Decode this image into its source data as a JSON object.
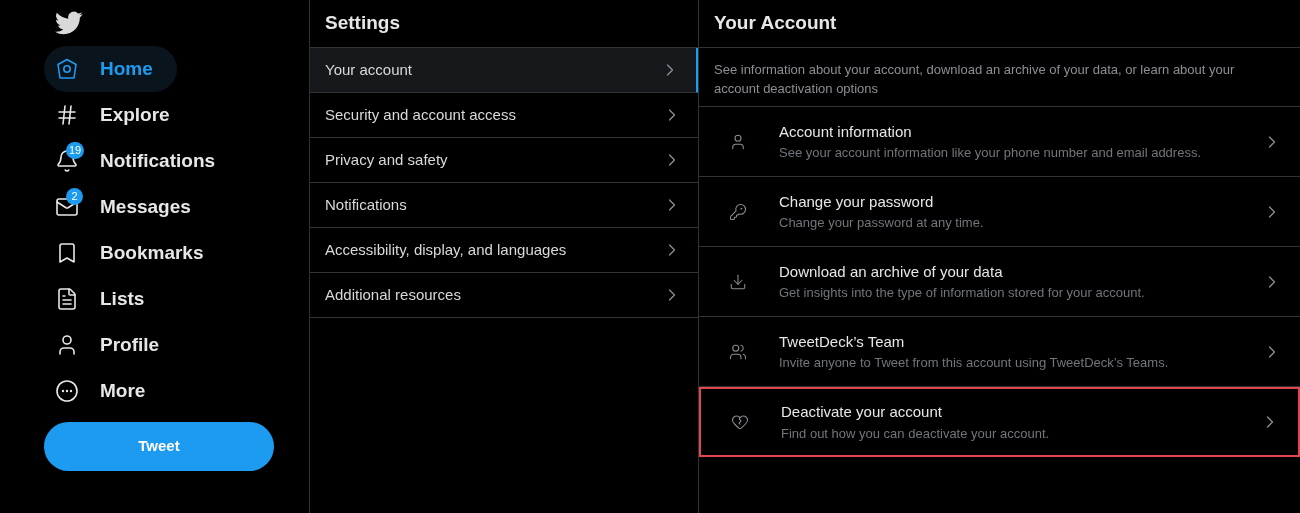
{
  "nav": {
    "items": [
      {
        "label": "Home",
        "selected": true
      },
      {
        "label": "Explore",
        "selected": false
      },
      {
        "label": "Notifications",
        "selected": false,
        "badge": "19"
      },
      {
        "label": "Messages",
        "selected": false,
        "badge": "2"
      },
      {
        "label": "Bookmarks",
        "selected": false
      },
      {
        "label": "Lists",
        "selected": false
      },
      {
        "label": "Profile",
        "selected": false
      },
      {
        "label": "More",
        "selected": false
      }
    ],
    "tweet_button": "Tweet"
  },
  "settings": {
    "title": "Settings",
    "items": [
      {
        "label": "Your account",
        "selected": true
      },
      {
        "label": "Security and account access",
        "selected": false
      },
      {
        "label": "Privacy and safety",
        "selected": false
      },
      {
        "label": "Notifications",
        "selected": false
      },
      {
        "label": "Accessibility, display, and languages",
        "selected": false
      },
      {
        "label": "Additional resources",
        "selected": false
      }
    ]
  },
  "account": {
    "title": "Your Account",
    "description": "See information about your account, download an archive of your data, or learn about your account deactivation options",
    "items": [
      {
        "title": "Account information",
        "subtitle": "See your account information like your phone number and email address.",
        "highlighted": false
      },
      {
        "title": "Change your password",
        "subtitle": "Change your password at any time.",
        "highlighted": false
      },
      {
        "title": "Download an archive of your data",
        "subtitle": "Get insights into the type of information stored for your account.",
        "highlighted": false
      },
      {
        "title": "TweetDeck’s Team",
        "subtitle": "Invite anyone to Tweet from this account using TweetDeck’s Teams.",
        "highlighted": false
      },
      {
        "title": "Deactivate your account",
        "subtitle": "Find out how you can deactivate your account.",
        "highlighted": true
      }
    ]
  }
}
